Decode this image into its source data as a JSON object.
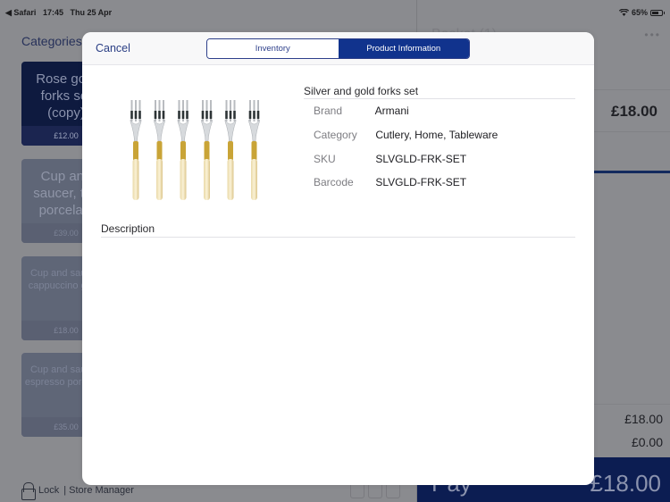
{
  "status_bar": {
    "back_app": "◀ Safari",
    "time": "17:45",
    "date": "Thu 25 Apr",
    "wifi_icon": "wifi-icon",
    "battery_percent": "65%"
  },
  "catalog": {
    "title": "Categories",
    "products": [
      {
        "name": "Rose gold forks set (copy)",
        "price": "£12.00"
      },
      {
        "name": "Cup and saucer, tea porcelain",
        "price": "£39.00"
      },
      {
        "name": "Cup and saucer, cappuccino glass",
        "price": "£18.00"
      },
      {
        "name": "Cup and saucer, espresso porcelain",
        "price": "£35.00"
      }
    ],
    "lock_label": "Lock",
    "user_label": "| Store Manager"
  },
  "basket": {
    "title": "Basket (1)",
    "more_icon": "ellipsis-icon",
    "line_price": "£18.00",
    "subtotal": "£18.00",
    "discount": "£0.00",
    "pay_label": "Pay",
    "pay_amount": "£18.00",
    "accent_color": "#0c1d52"
  },
  "modal": {
    "cancel_label": "Cancel",
    "tabs": [
      {
        "label": "Inventory",
        "active": false
      },
      {
        "label": "Product Information",
        "active": true
      }
    ],
    "product": {
      "name": "Silver and gold forks set",
      "image": "forks-set-image",
      "attributes": [
        {
          "key": "Brand",
          "value": "Armani"
        },
        {
          "key": "Category",
          "value": "Cutlery, Home, Tableware"
        },
        {
          "key": "SKU",
          "value": "SLVGLD-FRK-SET"
        },
        {
          "key": "Barcode",
          "value": "SLVGLD-FRK-SET"
        }
      ],
      "description_label": "Description",
      "description": ""
    },
    "accent_color": "#11338d"
  }
}
